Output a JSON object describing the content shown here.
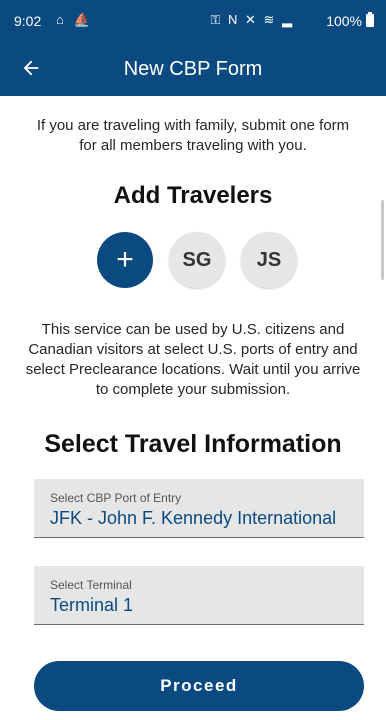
{
  "status_bar": {
    "time": "9:02",
    "left_icons": "⌂ ⛵",
    "right_icons": "⚿ N ✕ ≋ ▂",
    "battery": "100%"
  },
  "app_bar": {
    "back_icon": "arrow-left",
    "title": "New CBP Form"
  },
  "intro_text": "If you are traveling with family, submit one form for all members traveling with you.",
  "travelers_section": {
    "heading": "Add Travelers",
    "add_symbol": "+",
    "travelers": [
      {
        "initials": "SG"
      },
      {
        "initials": "JS"
      }
    ]
  },
  "notice_text": "This service can be used by U.S. citizens and Canadian visitors at select U.S. ports of entry and select Preclearance locations. Wait until you arrive to complete your submission.",
  "travel_info": {
    "heading": "Select Travel Information",
    "port": {
      "label": "Select CBP Port of Entry",
      "value": "JFK - John F. Kennedy International"
    },
    "terminal": {
      "label": "Select Terminal",
      "value": "Terminal 1"
    }
  },
  "proceed_label": "Proceed",
  "colors": {
    "primary": "#0a4a80",
    "field_bg": "#e6e6e6",
    "avatar_bg": "#e6e6e6"
  }
}
